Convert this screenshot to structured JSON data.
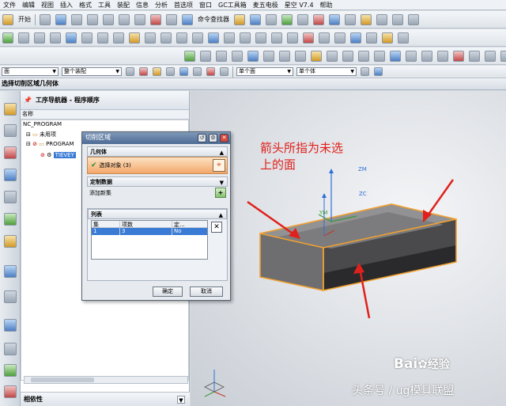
{
  "menubar": {
    "items": [
      "文件",
      "编辑",
      "视图",
      "插入",
      "格式",
      "工具",
      "装配",
      "信息",
      "分析",
      "首选项",
      "窗口",
      "GC工具箱",
      "麦五电极",
      "星空 V7.4",
      "帮助"
    ]
  },
  "toolbar1": {
    "start_label": "开始",
    "command_finder_label": "命令查找器"
  },
  "toolbar4": {
    "filter_select": "面",
    "assembly_select": "整个装配",
    "face_select": "单个面",
    "follow_select": "单个体"
  },
  "titlebar": {
    "title": "选择切削区域几何体"
  },
  "navigator": {
    "header": "工序导航器 - 程序顺序",
    "column_name": "名称",
    "tree": {
      "root": "NC_PROGRAM",
      "unused": "未用项",
      "program": "PROGRAM",
      "op": "TIEVEY"
    },
    "footer": "相依性"
  },
  "dialog": {
    "title": "切削区域",
    "geometry_group": "几何体",
    "select_object": "选择对象 (3)",
    "custom_data": "定制数据",
    "add_set": "添加新集",
    "list_group": "列表",
    "list_headers": [
      "集",
      "项数",
      "定..."
    ],
    "list_row": [
      "1",
      "3",
      "No"
    ],
    "ok": "确定",
    "cancel": "取消"
  },
  "viewport": {
    "annotation_line1": "箭头所指为未选",
    "annotation_line2": "上的面",
    "axis_zm": "ZM",
    "axis_zc": "ZC",
    "axis_ym": "YM",
    "arrow_color": "#e0211b",
    "edge_color": "#f0a030"
  },
  "watermark": {
    "baidu": "Bai",
    "jingyan": "经验",
    "source": "头条号 / ug模具联盟"
  }
}
